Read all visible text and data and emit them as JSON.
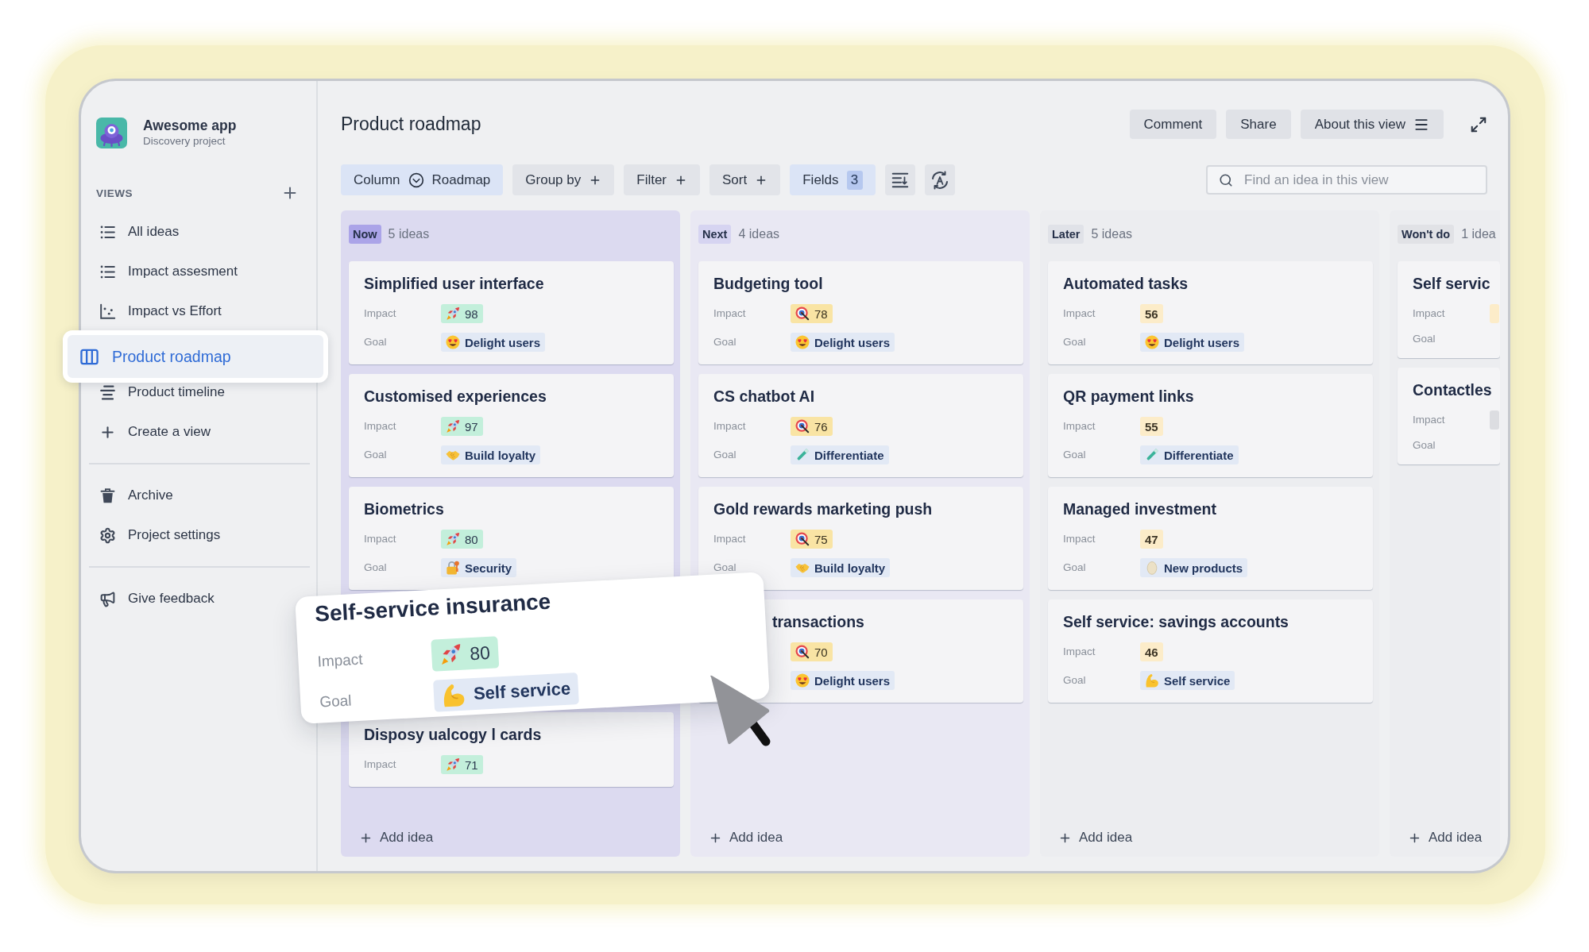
{
  "app": {
    "name": "Awesome app",
    "project": "Discovery project"
  },
  "sidebar": {
    "views_heading": "VIEWS",
    "views": [
      {
        "label": "All ideas",
        "kind": "list",
        "selected": false
      },
      {
        "label": "Impact assesment",
        "kind": "list",
        "selected": false
      },
      {
        "label": "Impact vs Effort",
        "kind": "scatter",
        "selected": false
      },
      {
        "label": "Product roadmap",
        "kind": "board",
        "selected": true
      },
      {
        "label": "Product timeline",
        "kind": "timeline",
        "selected": false
      },
      {
        "label": "Create a view",
        "kind": "add",
        "selected": false
      }
    ],
    "links": [
      {
        "label": "Archive",
        "kind": "trash"
      },
      {
        "label": "Project settings",
        "kind": "gear"
      }
    ],
    "feedback": {
      "label": "Give feedback",
      "kind": "megaphone"
    }
  },
  "header": {
    "title": "Product roadmap",
    "actions": [
      {
        "label": "Comment",
        "kind": "plain"
      },
      {
        "label": "Share",
        "kind": "plain"
      },
      {
        "label": "About this view",
        "kind": "menu"
      }
    ]
  },
  "toolbar": {
    "buttons": [
      {
        "kind": "view",
        "label": "Column",
        "value": "Roadmap",
        "active": true
      },
      {
        "kind": "add",
        "label": "Group by",
        "active": false
      },
      {
        "kind": "add",
        "label": "Filter",
        "active": false
      },
      {
        "kind": "add",
        "label": "Sort",
        "active": false
      },
      {
        "kind": "count",
        "label": "Fields",
        "count": "3",
        "active": true
      }
    ],
    "search": {
      "placeholder": "Find an idea in this view"
    }
  },
  "board": {
    "columns": [
      {
        "name": "Now",
        "count": "5 ideas",
        "color": "#aba4e8",
        "add_label": "Add idea",
        "cards": [
          {
            "kind": "idea",
            "title": "Simplified user interface",
            "impact": {
              "label": "Impact",
              "value": "98",
              "kind": "high"
            },
            "goal": {
              "label": "Goal",
              "text": "Delight users",
              "kind": "heart-eyes"
            }
          },
          {
            "kind": "idea",
            "title": "Customised experiences",
            "impact": {
              "label": "Impact",
              "value": "97",
              "kind": "high"
            },
            "goal": {
              "label": "Goal",
              "text": "Build loyalty",
              "kind": "handshake"
            }
          },
          {
            "kind": "idea",
            "title": "Biometrics",
            "impact": {
              "label": "Impact",
              "value": "80",
              "kind": "high"
            },
            "goal": {
              "label": "Goal",
              "text": "Security",
              "kind": "lock"
            }
          },
          {
            "kind": "placeholder"
          },
          {
            "kind": "idea",
            "title": "Disposy ualcogy l cards",
            "impact": {
              "label": "Impact",
              "value": "71",
              "kind": "high"
            }
          }
        ]
      },
      {
        "name": "Next",
        "count": "4 ideas",
        "color": "#d6d4f1",
        "add_label": "Add idea",
        "cards": [
          {
            "kind": "idea",
            "title": "Budgeting tool",
            "impact": {
              "label": "Impact",
              "value": "78",
              "kind": "medium"
            },
            "goal": {
              "label": "Goal",
              "text": "Delight users",
              "kind": "heart-eyes"
            }
          },
          {
            "kind": "idea",
            "title": "CS chatbot AI",
            "impact": {
              "label": "Impact",
              "value": "76",
              "kind": "medium"
            },
            "goal": {
              "label": "Goal",
              "text": "Differentiate",
              "kind": "test-tube"
            }
          },
          {
            "kind": "idea",
            "title": "Gold rewards marketing push",
            "impact": {
              "label": "Impact",
              "value": "75",
              "kind": "medium"
            },
            "goal": {
              "label": "Goal",
              "text": "Build loyalty",
              "kind": "handshake"
            }
          },
          {
            "kind": "covered",
            "title": "transactions",
            "impact": {
              "value": "70",
              "kind": "medium"
            },
            "goal": {
              "text": "Delight users",
              "kind": "heart-eyes"
            }
          }
        ]
      },
      {
        "name": "Later",
        "count": "5 ideas",
        "color": "#e0e2e8",
        "add_label": "Add idea",
        "cards": [
          {
            "kind": "idea",
            "title": "Automated tasks",
            "impact": {
              "label": "Impact",
              "value": "56",
              "kind": "low"
            },
            "goal": {
              "label": "Goal",
              "text": "Delight users",
              "kind": "heart-eyes"
            }
          },
          {
            "kind": "idea",
            "title": "QR payment links",
            "impact": {
              "label": "Impact",
              "value": "55",
              "kind": "low"
            },
            "goal": {
              "label": "Goal",
              "text": "Differentiate",
              "kind": "test-tube"
            }
          },
          {
            "kind": "idea",
            "title": "Managed investment",
            "impact": {
              "label": "Impact",
              "value": "47",
              "kind": "low"
            },
            "goal": {
              "label": "Goal",
              "text": "New products",
              "kind": "egg"
            }
          },
          {
            "kind": "idea",
            "title": "Self service: savings accounts",
            "impact": {
              "label": "Impact",
              "value": "46",
              "kind": "low"
            },
            "goal": {
              "label": "Goal",
              "text": "Self service",
              "kind": "arm"
            }
          }
        ]
      },
      {
        "name": "Won't do",
        "count": "1 idea",
        "color": "#e1e2e6",
        "add_label": "Add idea",
        "cards": [
          {
            "kind": "idea",
            "title": "Self servic",
            "impact": {
              "label": "Impact",
              "kind": "low"
            },
            "goal": {
              "label": "Goal"
            }
          },
          {
            "kind": "idea",
            "title": "Contactles",
            "impact": {
              "label": "Impact",
              "kind": "minimal"
            },
            "goal": {
              "label": "Goal"
            }
          }
        ]
      }
    ]
  },
  "dragged_card": {
    "title": "Self-service insurance",
    "impact": {
      "label": "Impact",
      "value": "80",
      "kind": "high"
    },
    "goal": {
      "label": "Goal",
      "text": "Self service",
      "kind": "arm"
    }
  }
}
